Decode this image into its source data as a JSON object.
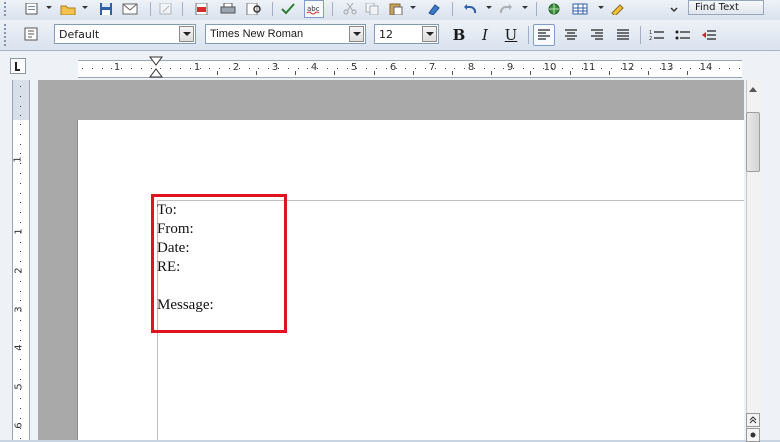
{
  "toolbar": {
    "find_text_label": "Find Text"
  },
  "formatting": {
    "paragraph_style": "Default",
    "font_name": "Times New Roman",
    "font_size": "12",
    "bold_label": "B",
    "italic_label": "I",
    "underline_label": "U"
  },
  "ruler": {
    "h_numbers": [
      "1",
      "1",
      "2",
      "3",
      "4",
      "5",
      "6",
      "7",
      "8",
      "9",
      "10",
      "11",
      "12",
      "13",
      "14"
    ],
    "v_numbers": [
      "1",
      "1",
      "2",
      "3",
      "4",
      "5",
      "6"
    ]
  },
  "document": {
    "lines": [
      "To:",
      "From:",
      "Date:",
      "RE:",
      "",
      "Message:"
    ]
  },
  "colors": {
    "highlight": "#e0141e",
    "page": "#ffffff",
    "workspace": "#a9a9a9"
  }
}
